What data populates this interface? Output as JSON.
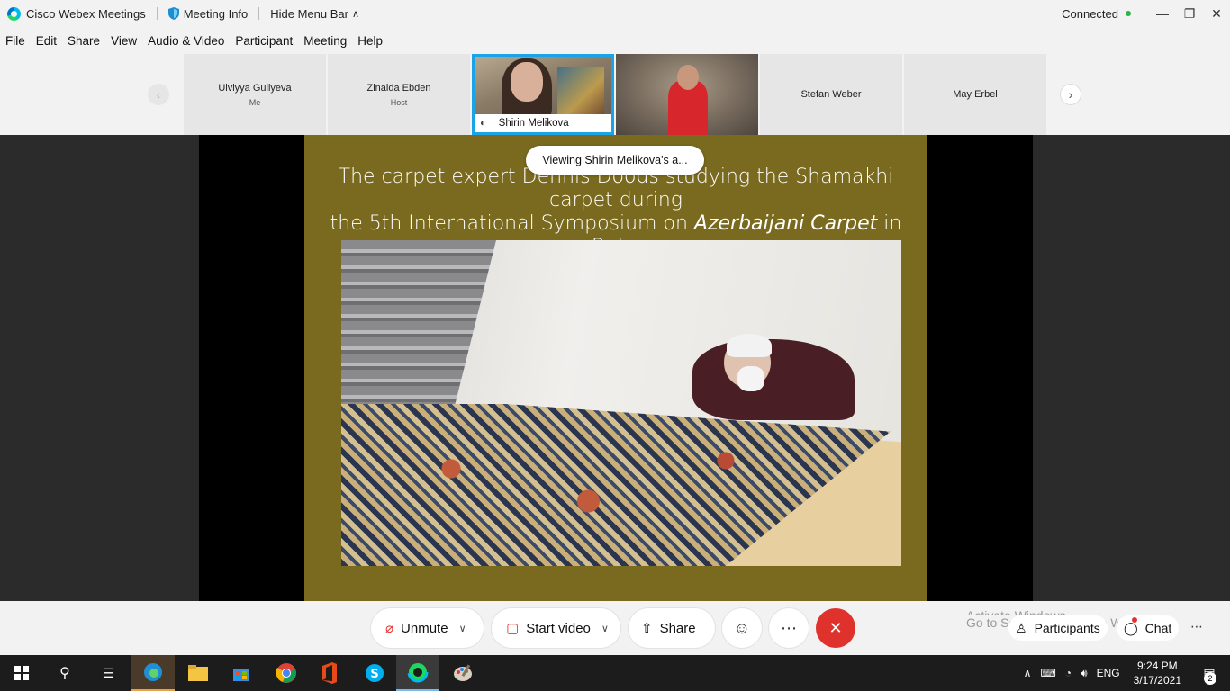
{
  "titlebar": {
    "app_name": "Cisco Webex Meetings",
    "meeting_info": "Meeting Info",
    "hide_menu_bar": "Hide Menu Bar",
    "status": "Connected"
  },
  "menu": [
    "File",
    "Edit",
    "Share",
    "View",
    "Audio & Video",
    "Participant",
    "Meeting",
    "Help"
  ],
  "participants": [
    {
      "name": "Ulviyya Guliyeva",
      "role": "Me"
    },
    {
      "name": "Zinaida Ebden",
      "role": "Host"
    },
    {
      "name": "Shirin Melikova",
      "role": ""
    },
    {
      "name": "",
      "role": ""
    },
    {
      "name": "Stefan Weber",
      "role": ""
    },
    {
      "name": "May Erbel",
      "role": ""
    }
  ],
  "stage": {
    "toast": "Viewing Shirin Melikova's a...",
    "slide_title_line1": "The carpet expert Dennis Doods studying the Shamakhi carpet during",
    "slide_title_line2_pre": "the 5th International Symposium on ",
    "slide_title_line2_em": "Azerbaijani Carpet",
    "slide_title_line2_post": " in Baku"
  },
  "controls": {
    "unmute": "Unmute",
    "start_video": "Start video",
    "share": "Share",
    "activate_line1": "Activate Windows",
    "activate_line2": "Go to Settings to activate Windows.",
    "participants": "Participants",
    "chat": "Chat"
  },
  "taskbar": {
    "language": "ENG",
    "time": "9:24 PM",
    "date": "3/17/2021",
    "notification_count": "2"
  },
  "colors": {
    "accent": "#1aa3e6",
    "end_call": "#e0322d",
    "slide_bg": "#7a6a1f",
    "connected": "#2fb344"
  }
}
